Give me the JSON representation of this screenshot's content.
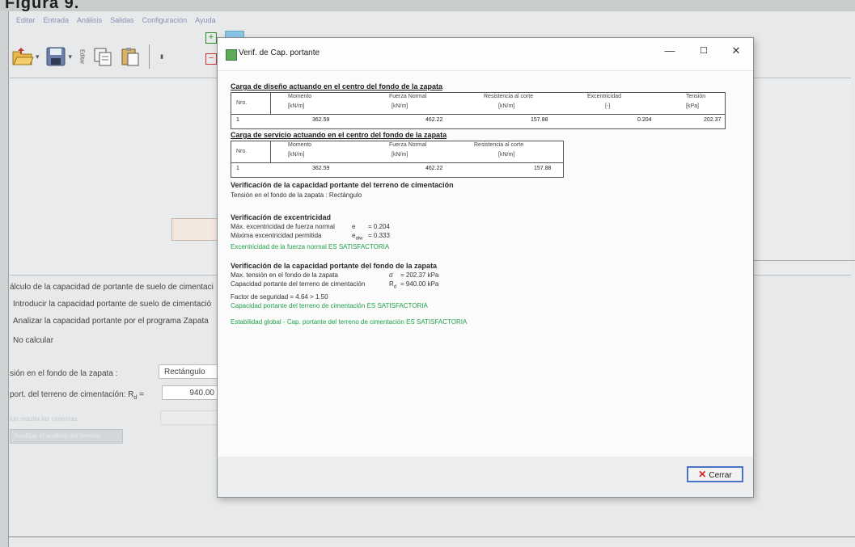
{
  "figure_caption": "Figura 9.",
  "menu": [
    "Editar",
    "Entrada",
    "Análisis",
    "Salidas",
    "Configuración",
    "Ayuda"
  ],
  "toolbar": {
    "open_icon": "folder-open-icon",
    "save_icon": "floppy-disk-icon",
    "copy_icon": "copy-icon",
    "paste_icon": "paste-icon",
    "vertical_label": "Editar"
  },
  "left_panel": {
    "group_title": "álculo de la capacidad de portante de suelo de cimentaci",
    "options": [
      "Introducir la capacidad portante de suelo de cimentació",
      "Analizar la capacidad portante por el programa Zapata",
      "No calcular"
    ],
    "shape_label": "sión en el fondo de la zapata :",
    "shape_value": "Rectángulo",
    "bearing_label": "port. del terreno de cimentación: R",
    "bearing_sub": "d",
    "bearing_value": "940.00",
    "disabled_label": "luo resulta las cimentas",
    "disabled_button": "Realizar el análisis del terreno"
  },
  "dialog": {
    "title": "Verif. de Cap. portante",
    "close_button": "Cerrar",
    "section1": {
      "title": "Carga de diseño actuando en el centro del fondo de la zapata",
      "headers": [
        {
          "name": "Nro.",
          "unit": ""
        },
        {
          "name": "Momento",
          "unit": "[kN/m]"
        },
        {
          "name": "Fuerza Normal",
          "unit": "[kN/m]"
        },
        {
          "name": "Resistencia al corte",
          "unit": "[kN/m]"
        },
        {
          "name": "Excentricidad",
          "unit": "[-]"
        },
        {
          "name": "Tensión",
          "unit": "[kPa]"
        }
      ],
      "rows": [
        [
          "1",
          "362.59",
          "462.22",
          "157.88",
          "0.204",
          "202.37"
        ]
      ]
    },
    "section2": {
      "title": "Carga de servicio actuando en el centro del fondo de la zapata",
      "headers": [
        {
          "name": "Nro.",
          "unit": ""
        },
        {
          "name": "Momento",
          "unit": "[kN/m]"
        },
        {
          "name": "Fuerza Normal",
          "unit": "[kN/m]"
        },
        {
          "name": "Resistencia al corte",
          "unit": "[kN/m]"
        }
      ],
      "rows": [
        [
          "1",
          "362.59",
          "462.22",
          "157.88"
        ]
      ]
    },
    "verif1": {
      "heading": "Verificación de la capacidad portante del terreno de cimentación",
      "line": "Tensión en el fondo de la zapata : Rectángulo"
    },
    "verif2": {
      "heading": "Verificación de excentricidad",
      "l1_label": "Máx. excentricidad de fuerza normal",
      "l1_sym": "e",
      "l1_val": "= 0.204",
      "l2_label": "Máxima excentricidad permitida",
      "l2_sym": "e",
      "l2_sub": "alw",
      "l2_val": "= 0.333",
      "result": "Excentricidad de la fuerza normal ES SATISFACTORIA"
    },
    "verif3": {
      "heading": "Verificación de la capacidad portante del fondo de la zapata",
      "l1_label": "Max. tensión en el fondo de la zapata",
      "l1_sym": "σ",
      "l1_val": "= 202.37 kPa",
      "l2_label": "Capacidad portante del terreno de cimentación",
      "l2_sym": "R",
      "l2_sub": "d",
      "l2_val": "= 940.00 kPa",
      "factor": "Factor de seguridad = 4.64 > 1.50",
      "result": "Capacidad portante del terreno de cimentación ES SATISFACTORIA"
    },
    "global": "Estabilidad global - Cap. portante del terreno de cimentación ES SATISFACTORIA"
  }
}
